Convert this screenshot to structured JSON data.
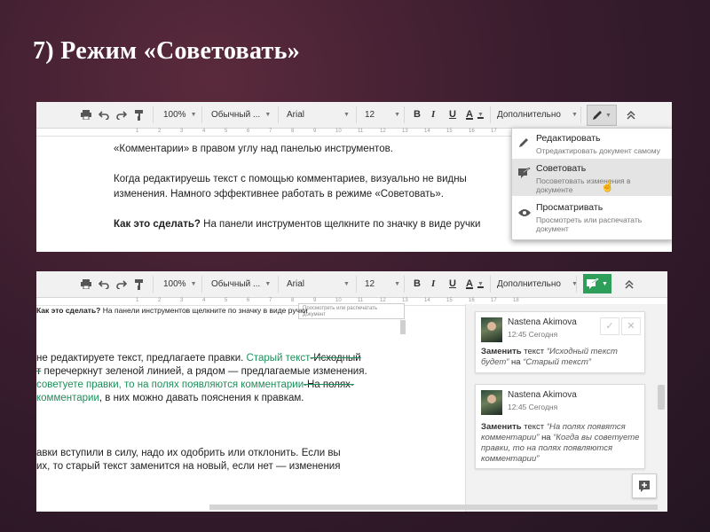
{
  "slide": {
    "title": "7) Режим «Советовать»"
  },
  "toolbar": {
    "zoom": "100%",
    "style": "Обычный ...",
    "font": "Arial",
    "size": "12",
    "bold": "B",
    "italic": "I",
    "underline": "U",
    "textcolor": "A",
    "more": "Дополнительно"
  },
  "ruler": [
    "1",
    "2",
    "3",
    "4",
    "5",
    "6",
    "7",
    "8",
    "9",
    "10",
    "11",
    "12",
    "13",
    "14",
    "15",
    "16",
    "17",
    "18"
  ],
  "screenshot1": {
    "lines": [
      "«Комментарии» в правом углу над панелью инструментов.",
      "Когда редактируешь текст с помощью комментариев, визуально не видны",
      "изменения. Намного эффективнее работать в режиме «Советовать».",
      "Как это сделать?",
      " На панели инструментов щелкните по значку в виде ручки"
    ],
    "mode_menu": [
      {
        "label": "Редактировать",
        "desc": "Отредактировать документ самому"
      },
      {
        "label": "Советовать",
        "desc": "Посоветовать изменения в документе"
      },
      {
        "label": "Просматривать",
        "desc": "Просмотреть или распечатать документ"
      }
    ]
  },
  "screenshot2": {
    "tooltip": "Просмотреть или распечатать документ",
    "line0_bold": "Как это сделать?",
    "line0": " На панели инструментов щелкните по значку в виде ручки",
    "l1a": " не редактируете текст, предлагаете правки.",
    "l1b": " Старый текст",
    "l1c": "-Исходный",
    "l2a": "т",
    "l2b": " перечеркнут зеленой линией, а рядом — предлагаемые изменения.",
    "l3a": "советуете правки, то на полях появляются комментарии",
    "l3b": "-На полях-",
    "l4a": "комментарии",
    "l4b": ", в них можно давать пояснения к правкам.",
    "l5": "авки вступили в силу, надо их одобрить или отклонить. Если вы",
    "l6": " их, то старый текст заменится на новый, если нет — изменения",
    "comments": [
      {
        "name": "Nastena Akimova",
        "time": "12:45 Сегодня",
        "action": "Заменить",
        "word_text": "текст",
        "old": "“Исходный текст будет”",
        "on": "на",
        "new": "“Старый текст”"
      },
      {
        "name": "Nastena Akimova",
        "time": "12:45 Сегодня",
        "action": "Заменить",
        "word_text": "текст",
        "old": "“На полях появятся комментарии”",
        "on": "на",
        "new": "“Когда вы советуете правки, то на полях появляются комментарии”"
      }
    ]
  },
  "colors": {
    "green": "#1e8e5a",
    "suggest_button": "#2e9e5b"
  }
}
